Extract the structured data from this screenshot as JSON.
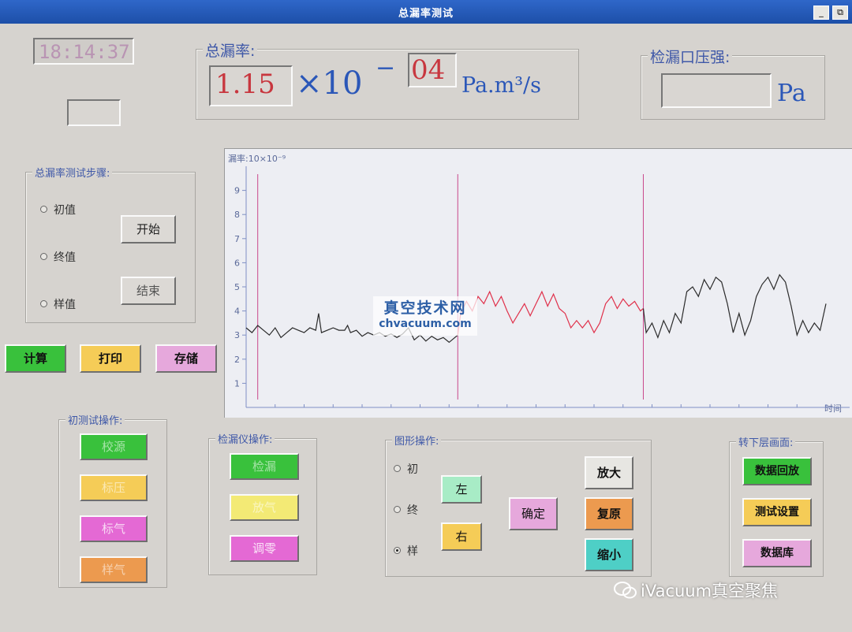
{
  "window": {
    "title": "总漏率测试",
    "minimize_glyph": "_",
    "restore_glyph": "⧉"
  },
  "clock": {
    "time": "18:14:37"
  },
  "leak_rate": {
    "legend": "总漏率:",
    "mantissa": "1.15",
    "times_ten": "×10",
    "minus": "−",
    "exponent": "04",
    "unit": "Pa.m³/s"
  },
  "pressure": {
    "legend": "检漏口压强:",
    "value": "",
    "unit": "Pa"
  },
  "steps": {
    "legend": "总漏率测试步骤:",
    "options": [
      {
        "label": "初值",
        "selected": false
      },
      {
        "label": "终值",
        "selected": false
      },
      {
        "label": "样值",
        "selected": false
      }
    ],
    "start_label": "开始",
    "end_label": "结束"
  },
  "actions": {
    "calc": "计算",
    "print": "打印",
    "store": "存储"
  },
  "colors": {
    "green": "#39c13c",
    "yellow": "#f5cc57",
    "pink": "#e6a8dc",
    "magenta": "#e469d4",
    "orange": "#ec9a4f",
    "teal": "#4ecfc6",
    "mint": "#a8ecc6",
    "light_yellow": "#f3ea75",
    "line_black": "#2a2a2a",
    "line_red": "#e0304a",
    "marker": "#c9488b"
  },
  "init_ops": {
    "legend": "初测试操作:",
    "buttons": [
      "校源",
      "标压",
      "标气",
      "样气"
    ]
  },
  "detector_ops": {
    "legend": "检漏仪操作:",
    "buttons": [
      "检漏",
      "放气",
      "调零"
    ]
  },
  "graph_ops": {
    "legend": "图形操作:",
    "radios": [
      {
        "label": "初",
        "selected": false
      },
      {
        "label": "终",
        "selected": false
      },
      {
        "label": "样",
        "selected": true
      }
    ],
    "left": "左",
    "right": "右",
    "confirm": "确定",
    "zoom_in": "放大",
    "reset": "复原",
    "zoom_out": "缩小"
  },
  "nav": {
    "legend": "转下层画面:",
    "buttons": [
      "数据回放",
      "测试设置",
      "数据库"
    ]
  },
  "chart_data": {
    "type": "line",
    "title": "漏率:10×10⁻⁹",
    "xlabel": "时间",
    "ylabel": "",
    "ylim": [
      0,
      10
    ],
    "yticks": [
      1,
      2,
      3,
      4,
      5,
      6,
      7,
      8,
      9
    ],
    "xlim": [
      0,
      100
    ],
    "markers_x": [
      2,
      36.5,
      68.5
    ],
    "series": [
      {
        "color": "#2a2a2a",
        "points": [
          [
            0,
            3.3
          ],
          [
            1,
            3.1
          ],
          [
            2,
            3.4
          ],
          [
            3,
            3.2
          ],
          [
            4,
            3.0
          ],
          [
            5,
            3.3
          ],
          [
            6,
            2.9
          ],
          [
            7,
            3.1
          ],
          [
            8,
            3.3
          ],
          [
            9,
            3.2
          ],
          [
            10,
            3.1
          ],
          [
            11,
            3.3
          ],
          [
            12,
            3.2
          ],
          [
            12.5,
            3.9
          ],
          [
            13,
            3.1
          ],
          [
            14,
            3.2
          ],
          [
            15,
            3.3
          ],
          [
            16,
            3.2
          ],
          [
            17,
            3.2
          ],
          [
            17.5,
            3.4
          ],
          [
            18,
            3.1
          ],
          [
            19,
            3.2
          ],
          [
            20,
            2.95
          ],
          [
            21,
            3.1
          ],
          [
            22,
            3.0
          ],
          [
            23,
            3.1
          ],
          [
            24,
            2.95
          ],
          [
            25,
            3.05
          ],
          [
            26,
            2.9
          ],
          [
            27,
            3.05
          ],
          [
            28,
            3.3
          ],
          [
            29,
            2.8
          ],
          [
            30,
            3.0
          ],
          [
            31,
            2.75
          ],
          [
            32,
            2.95
          ],
          [
            33,
            2.8
          ],
          [
            34,
            2.9
          ],
          [
            35,
            2.7
          ],
          [
            36,
            2.9
          ],
          [
            36.5,
            3.0
          ]
        ]
      },
      {
        "color": "#e0304a",
        "points": [
          [
            36.5,
            3.0
          ],
          [
            37,
            3.9
          ],
          [
            38,
            4.4
          ],
          [
            39,
            4.0
          ],
          [
            40,
            4.6
          ],
          [
            41,
            4.3
          ],
          [
            42,
            4.8
          ],
          [
            43,
            4.2
          ],
          [
            44,
            4.6
          ],
          [
            45,
            4.0
          ],
          [
            46,
            3.5
          ],
          [
            47,
            3.9
          ],
          [
            48,
            4.3
          ],
          [
            49,
            3.8
          ],
          [
            50,
            4.3
          ],
          [
            51,
            4.8
          ],
          [
            52,
            4.2
          ],
          [
            53,
            4.7
          ],
          [
            54,
            4.1
          ],
          [
            55,
            3.9
          ],
          [
            56,
            3.3
          ],
          [
            57,
            3.6
          ],
          [
            58,
            3.3
          ],
          [
            59,
            3.6
          ],
          [
            60,
            3.1
          ],
          [
            61,
            3.5
          ],
          [
            62,
            4.3
          ],
          [
            63,
            4.6
          ],
          [
            64,
            4.1
          ],
          [
            65,
            4.5
          ],
          [
            66,
            4.2
          ],
          [
            67,
            4.4
          ],
          [
            68,
            4.0
          ],
          [
            68.5,
            4.1
          ]
        ]
      },
      {
        "color": "#2a2a2a",
        "points": [
          [
            68.5,
            4.1
          ],
          [
            69,
            3.1
          ],
          [
            70,
            3.5
          ],
          [
            71,
            2.9
          ],
          [
            72,
            3.6
          ],
          [
            73,
            3.1
          ],
          [
            74,
            3.9
          ],
          [
            75,
            3.5
          ],
          [
            76,
            4.8
          ],
          [
            77,
            5.0
          ],
          [
            78,
            4.6
          ],
          [
            79,
            5.3
          ],
          [
            80,
            4.9
          ],
          [
            81,
            5.4
          ],
          [
            82,
            5.2
          ],
          [
            83,
            4.3
          ],
          [
            84,
            3.1
          ],
          [
            85,
            3.9
          ],
          [
            86,
            3.0
          ],
          [
            87,
            3.6
          ],
          [
            88,
            4.6
          ],
          [
            89,
            5.1
          ],
          [
            90,
            5.4
          ],
          [
            91,
            4.9
          ],
          [
            92,
            5.5
          ],
          [
            93,
            5.2
          ],
          [
            94,
            4.2
          ],
          [
            95,
            3.0
          ],
          [
            96,
            3.6
          ],
          [
            97,
            3.1
          ],
          [
            98,
            3.5
          ],
          [
            99,
            3.2
          ],
          [
            100,
            4.3
          ]
        ]
      }
    ]
  },
  "watermark": {
    "line1": "真空技术网",
    "line2": "chvacuum.com"
  },
  "brand": "iVacuum真空聚焦"
}
